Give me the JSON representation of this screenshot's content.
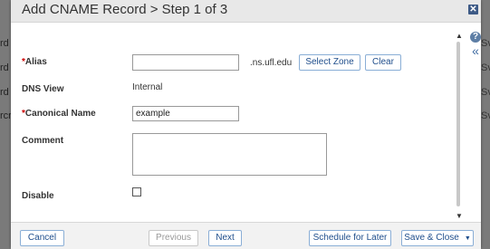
{
  "background_fragments": {
    "left": [
      "rd",
      "rd",
      "rd",
      "rcr"
    ],
    "right": [
      "Sv",
      "Sv",
      "Sv",
      "Sv"
    ]
  },
  "dialog": {
    "title": "Add CNAME Record > Step 1 of 3",
    "close_icon": "close-icon",
    "help_icon": "?",
    "collapse_icon": "«"
  },
  "form": {
    "alias": {
      "required_mark": "*",
      "label": "Alias",
      "value": "",
      "suffix": ".ns.ufl.edu"
    },
    "select_zone_label": "Select Zone",
    "clear_label": "Clear",
    "dns_view": {
      "label": "DNS View",
      "value": "Internal"
    },
    "canonical_name": {
      "required_mark": "*",
      "label": "Canonical Name",
      "value": "example"
    },
    "comment": {
      "label": "Comment",
      "value": ""
    },
    "disable": {
      "label": "Disable",
      "checked": false
    }
  },
  "footer": {
    "cancel_label": "Cancel",
    "previous_label": "Previous",
    "next_label": "Next",
    "schedule_label": "Schedule for Later",
    "save_close_label": "Save & Close",
    "save_close_caret": "▼"
  },
  "colors": {
    "button_text": "#1f4e8c",
    "button_border": "#8aaed6",
    "required": "#cc0000",
    "title_bar": "#e8e8e8"
  }
}
